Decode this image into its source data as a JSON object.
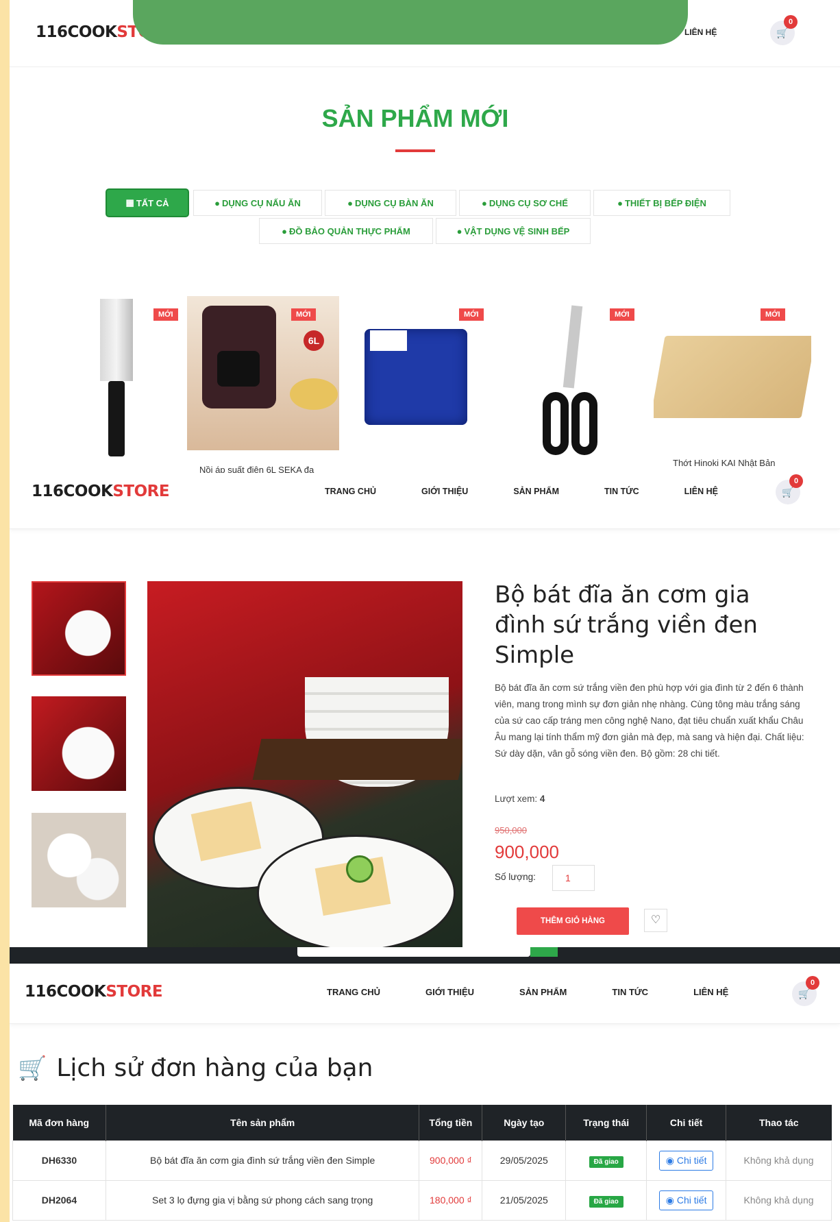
{
  "brand": {
    "part1": "116COOK",
    "part2": "STORE"
  },
  "nav": {
    "home": "TRANG CHỦ",
    "about": "GIỚI THIỆU",
    "products": "SẢN PHẨM",
    "news": "TIN TỨC",
    "contact": "LIÊN HỆ"
  },
  "cart_count": "0",
  "section1": {
    "title": "SẢN PHẨM MỚI",
    "tabs": [
      "TẤT CẢ",
      "DỤNG CỤ NẤU ĂN",
      "DỤNG CỤ BÀN ĂN",
      "DỤNG CỤ SƠ CHẾ",
      "THIẾT BỊ BẾP ĐIỆN",
      "ĐỒ BẢO QUẢN THỰC PHẨM",
      "VẬT DỤNG VỆ SINH BẾP"
    ],
    "badge": "MỚI",
    "products": [
      "Nồi áp suất điện 6L SEKA đa",
      "Thớt Hinoki KAI Nhật Bản"
    ],
    "cooker_label": "6L"
  },
  "detail": {
    "title": "Bộ bát đĩa ăn cơm gia đình sứ trắng viền đen Simple",
    "desc": "Bộ bát đĩa ăn cơm sứ trắng viền đen phù hợp với gia đình từ 2 đến 6 thành viên, mang trong mình sự đơn giản nhẹ nhàng. Cùng tông màu trắng sáng của sứ cao cấp tráng men công nghệ Nano, đạt tiêu chuẩn xuất khẩu Châu Âu mang lại tính thẩm mỹ đơn giản mà đẹp, mà sang và hiện đại. Chất liệu: Sứ dày dặn, vân gỗ sóng viền đen. Bộ gồm: 28 chi tiết.",
    "views_label": "Lượt xem:",
    "views": "4",
    "old_price": "950,000",
    "price": "900,000",
    "qty_label": "Số lượng:",
    "qty": "1",
    "add_cart": "THÊM GIỎ HÀNG"
  },
  "orders": {
    "title": "Lịch sử đơn hàng của bạn",
    "headers": [
      "Mã đơn hàng",
      "Tên sản phẩm",
      "Tổng tiền",
      "Ngày tạo",
      "Trạng thái",
      "Chi tiết",
      "Thao tác"
    ],
    "rows": [
      {
        "id": "DH6330",
        "name": "Bộ bát đĩa ăn cơm gia đình sứ trắng viền đen Simple",
        "total": "900,000 ₫",
        "date": "29/05/2025",
        "status": "Đã giao",
        "detail": "Chi tiết",
        "action": "Không khả dụng"
      },
      {
        "id": "DH2064",
        "name": "Set 3 lọ đựng gia vị bằng sứ phong cách sang trọng",
        "total": "180,000 ₫",
        "date": "21/05/2025",
        "status": "Đã giao",
        "detail": "Chi tiết",
        "action": "Không khả dụng"
      }
    ]
  },
  "colors": {
    "accent_green": "#2ea84a",
    "accent_red": "#e23a3a",
    "bg": "#fbe3a6"
  }
}
